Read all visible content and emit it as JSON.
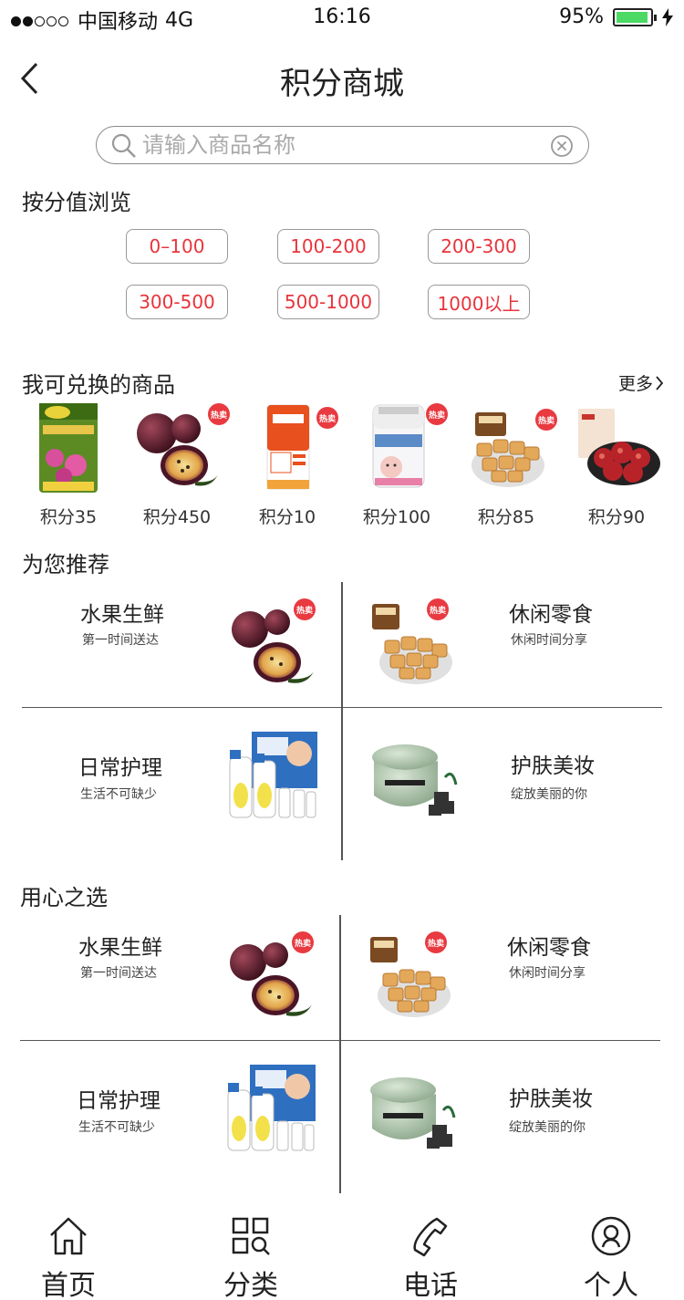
{
  "status_bar": {
    "carrier": "中国移动",
    "network": "4G",
    "time": "16:16",
    "battery": "95%",
    "battery_level": 0.95
  },
  "nav": {
    "title": "积分商城"
  },
  "search": {
    "placeholder": "请输入商品名称",
    "value": ""
  },
  "browse": {
    "title": "按分值浏览",
    "ranges": [
      "0–100",
      "100-200",
      "200-300",
      "300-500",
      "500-1000",
      "1000以上"
    ]
  },
  "exchange": {
    "title": "我可兑换的商品",
    "more": "更多",
    "products": [
      {
        "price": "积分35",
        "icon": "soil-bag-product-image",
        "hot": false
      },
      {
        "price": "积分450",
        "icon": "passion-fruit-product-image",
        "hot": true,
        "hot_label": "热卖"
      },
      {
        "price": "积分10",
        "icon": "cleanser-tube-product-image",
        "hot": true,
        "hot_label": "热卖"
      },
      {
        "price": "积分100",
        "icon": "cotton-swab-product-image",
        "hot": true,
        "hot_label": "热卖"
      },
      {
        "price": "积分85",
        "icon": "snack-product-image",
        "hot": true,
        "hot_label": "热卖"
      },
      {
        "price": "积分90",
        "icon": "dried-meat-product-image",
        "hot": false
      }
    ]
  },
  "recommend": {
    "title": "为您推荐",
    "items": [
      {
        "title": "水果生鲜",
        "subtitle": "第一时间送达",
        "hot_label": "热卖"
      },
      {
        "title": "休闲零食",
        "subtitle": "休闲时间分享",
        "hot_label": "热卖"
      },
      {
        "title": "日常护理",
        "subtitle": "生活不可缺少"
      },
      {
        "title": "护肤美妆",
        "subtitle": "绽放美丽的你"
      }
    ]
  },
  "selected": {
    "title": "用心之选",
    "items": [
      {
        "title": "水果生鲜",
        "subtitle": "第一时间送达",
        "hot_label": "热卖"
      },
      {
        "title": "休闲零食",
        "subtitle": "休闲时间分享",
        "hot_label": "热卖"
      },
      {
        "title": "日常护理",
        "subtitle": "生活不可缺少"
      },
      {
        "title": "护肤美妆",
        "subtitle": "绽放美丽的你"
      }
    ]
  },
  "tabbar": [
    {
      "label": "首页",
      "icon": "home-icon"
    },
    {
      "label": "分类",
      "icon": "category-icon"
    },
    {
      "label": "电话",
      "icon": "phone-icon"
    },
    {
      "label": "个人",
      "icon": "user-icon"
    }
  ],
  "colors": {
    "accent": "#e8343c",
    "battery": "#4cd964"
  }
}
